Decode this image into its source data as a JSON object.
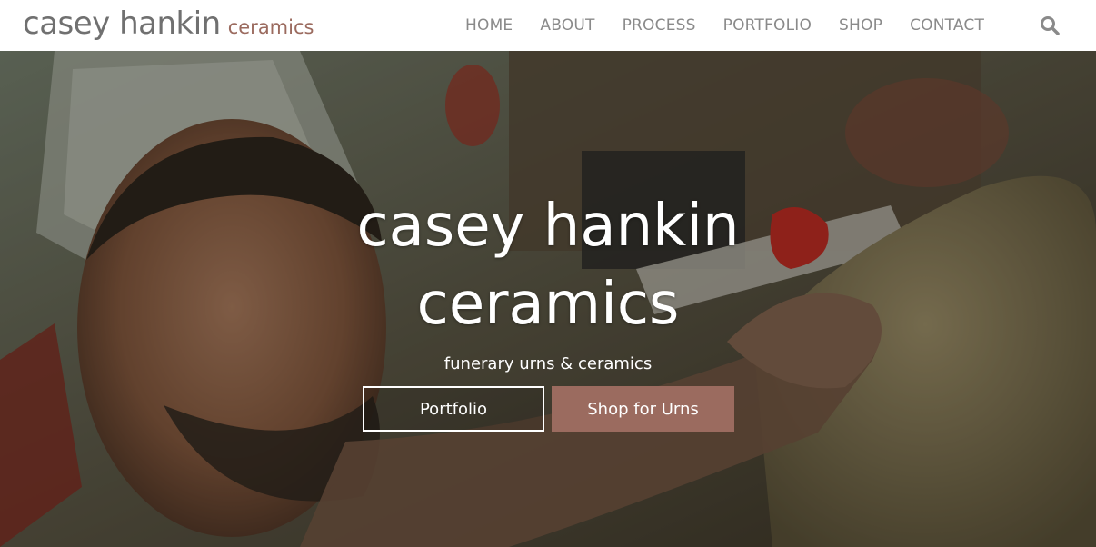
{
  "header": {
    "logo_main": "casey hankin",
    "logo_sub": "ceramics",
    "nav": [
      {
        "label": "HOME"
      },
      {
        "label": "ABOUT"
      },
      {
        "label": "PROCESS"
      },
      {
        "label": "PORTFOLIO"
      },
      {
        "label": "SHOP"
      },
      {
        "label": "CONTACT"
      }
    ],
    "search_icon": "search-icon"
  },
  "hero": {
    "title": "casey hankin ceramics",
    "subtitle": "funerary urns & ceramics",
    "buttons": {
      "primary": "Portfolio",
      "secondary": "Shop for Urns"
    }
  },
  "colors": {
    "accent": "#9b6b5f",
    "nav_text": "#8a8a8a",
    "logo_text": "#707070",
    "header_bg": "#ffffff"
  }
}
